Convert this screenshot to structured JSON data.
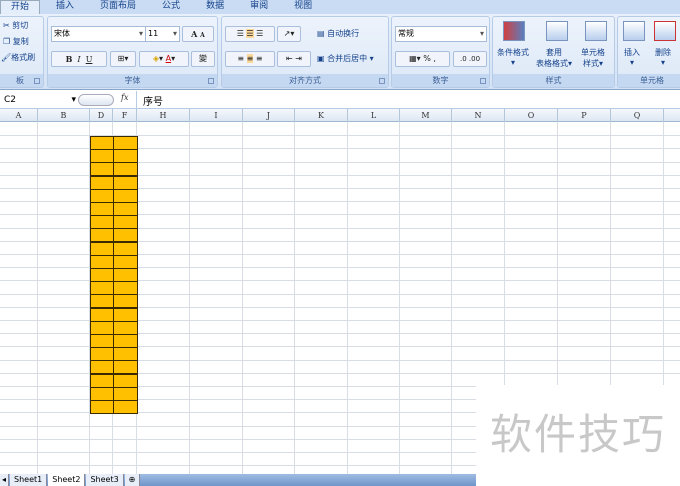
{
  "tabs": [
    "开始",
    "插入",
    "页面布局",
    "公式",
    "数据",
    "审阅",
    "视图"
  ],
  "clipboard": {
    "cut": "剪切",
    "copy": "复制",
    "painter": "格式刷",
    "label": "板"
  },
  "font": {
    "name": "宋体",
    "size": "11",
    "label": "字体",
    "bold": "B",
    "italic": "I",
    "underline": "U",
    "grow": "A",
    "shrink": "A",
    "color_glyph": "A",
    "phonetic": "變"
  },
  "alignment": {
    "wrap": "自动换行",
    "merge": "合并后居中",
    "label": "对齐方式"
  },
  "number": {
    "format": "常规",
    "percent": "%",
    "comma": ",",
    "inc": ".0",
    "dec": ".00",
    "label": "数字"
  },
  "styles": {
    "conditional": "条件格式",
    "table1": "套用",
    "table2": "表格格式",
    "cell1": "单元格",
    "cell2": "样式",
    "label": "样式"
  },
  "cells": {
    "insert": "插入",
    "delete": "删除",
    "label": "单元格"
  },
  "formula_bar": {
    "name_box": "C2",
    "fx": "fx",
    "value": "序号"
  },
  "columns": [
    "A",
    "B",
    "D",
    "F",
    "H",
    "I",
    "J",
    "K",
    "L",
    "M",
    "N",
    "O",
    "P",
    "Q"
  ],
  "sheets": [
    "Sheet1",
    "Sheet2",
    "Sheet3"
  ],
  "active_sheet": "Sheet2",
  "highlight_color": "#ffc000",
  "watermark": "软件技巧"
}
